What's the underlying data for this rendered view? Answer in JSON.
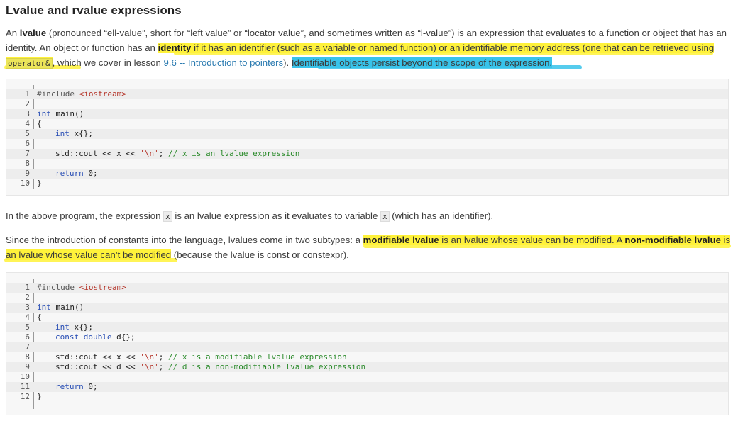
{
  "heading": "Lvalue and rvalue expressions",
  "para1": {
    "t1": "An ",
    "lvalue": "lvalue",
    "t2": " (pronounced “ell-value”, short for “left value” or “locator value”, and sometimes written as “l-value”) is an expression that evaluates to a function or object that has an identity. An object or function has an ",
    "identity": "identity",
    "t3": " if it has an identifier (such as a variable or named function) or an identifiable memory address (one that can be retrieved using ",
    "operator": "operator&",
    "t4": ", which we cover in lesson ",
    "link": "9.6 -- Introduction to pointers",
    "t5": "). ",
    "blue": "Identifiable objects persist beyond the scope of the expression."
  },
  "para2": {
    "t1": "In the above program, the expression ",
    "x1": "x",
    "t2": " is an lvalue expression as it evaluates to variable ",
    "x2": "x",
    "t3": " (which has an identifier)."
  },
  "para3": {
    "t1": "Since the introduction of constants into the language, lvalues come in two subtypes: a ",
    "mod": "modifiable lvalue",
    "t2": " is an lvalue whose value can be modified. A ",
    "nonmod": "non-modifiable lvalue",
    "t3": " is an lvalue whose value can’t be modified",
    "t4": " (because the lvalue is const or constexpr)."
  },
  "code1": {
    "line_numbers": [
      "1",
      "2",
      "3",
      "4",
      "5",
      "6",
      "7",
      "8",
      "9",
      "10"
    ],
    "include_kw": "#include",
    "include_path": "<iostream>",
    "main_kw": "int",
    "main_rest": " main()",
    "open": "{",
    "l5_kw": "int",
    "l5_rest": " x{};",
    "l7_a": "std::cout << x << ",
    "l7_str": "'\\n'",
    "l7_b": "; ",
    "l7_com": "// x is an lvalue expression",
    "ret_kw": "return",
    "ret_rest": " 0;",
    "close": "}"
  },
  "code2": {
    "line_numbers": [
      "1",
      "2",
      "3",
      "4",
      "5",
      "6",
      "7",
      "8",
      "9",
      "10",
      "11",
      "12"
    ],
    "include_kw": "#include",
    "include_path": "<iostream>",
    "main_kw": "int",
    "main_rest": " main()",
    "open": "{",
    "l5_kw": "int",
    "l5_rest": " x{};",
    "l6_kw": "const double",
    "l6_rest": " d{};",
    "l8_a": "std::cout << x << ",
    "l8_str": "'\\n'",
    "l8_b": "; ",
    "l8_com": "// x is a modifiable lvalue expression",
    "l9_a": "std::cout << d << ",
    "l9_str": "'\\n'",
    "l9_b": "; ",
    "l9_com": "// d is a non-modifiable lvalue expression",
    "ret_kw": "return",
    "ret_rest": " 0;",
    "close": "}"
  },
  "colors": {
    "highlight_yellow": "#fff23a",
    "highlight_blue": "#38c3ea",
    "link": "#2a7ab0",
    "keyword": "#2a4fb5",
    "string": "#b5352a",
    "comment": "#2a8a2a"
  }
}
